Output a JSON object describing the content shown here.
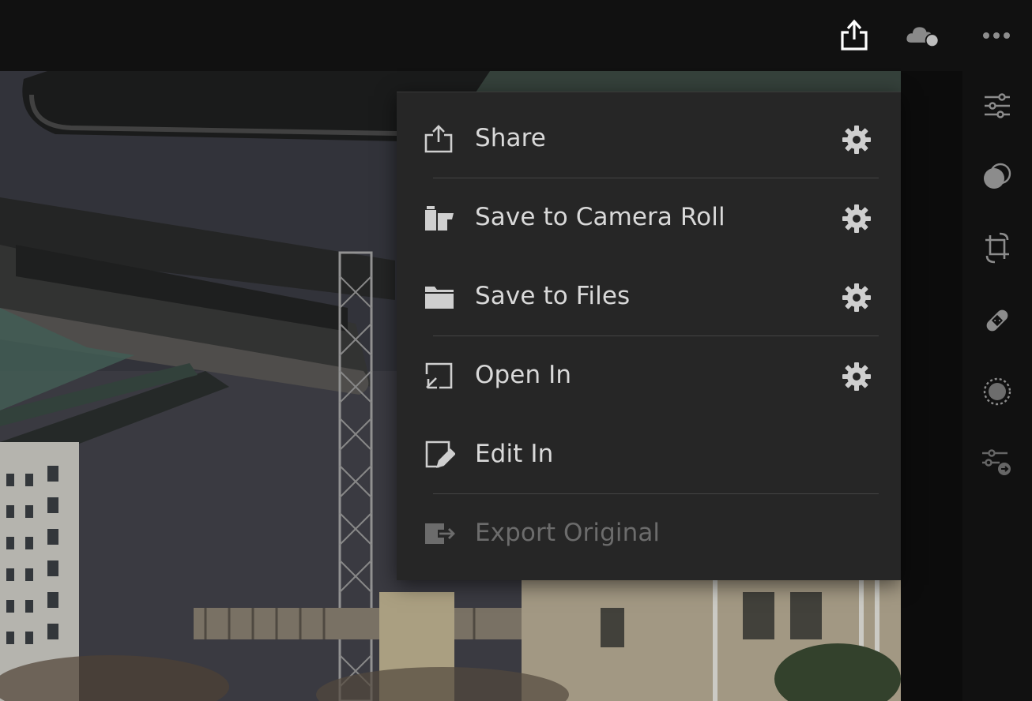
{
  "topbar": {
    "icons": [
      "share-icon",
      "cloud-sync-icon",
      "more-icon"
    ]
  },
  "menu": {
    "items": [
      {
        "label": "Share",
        "icon": "share-icon",
        "has_settings": true,
        "enabled": true
      },
      {
        "label": "Save to Camera Roll",
        "icon": "camera-roll-icon",
        "has_settings": true,
        "enabled": true
      },
      {
        "label": "Save to Files",
        "icon": "folder-icon",
        "has_settings": true,
        "enabled": true
      },
      {
        "label": "Open In",
        "icon": "open-in-icon",
        "has_settings": true,
        "enabled": true
      },
      {
        "label": "Edit In",
        "icon": "edit-in-icon",
        "has_settings": false,
        "enabled": true
      },
      {
        "label": "Export Original",
        "icon": "export-original-icon",
        "has_settings": false,
        "enabled": false
      }
    ]
  },
  "sidebar": {
    "tools": [
      "adjust-sliders-icon",
      "presets-icon",
      "crop-icon",
      "healing-icon",
      "selective-icon",
      "versions-icon"
    ]
  },
  "colors": {
    "menu_bg": "#262626",
    "text": "#d9d9d9",
    "disabled_text": "#6c6c6c",
    "topbar_bg": "#111111"
  }
}
